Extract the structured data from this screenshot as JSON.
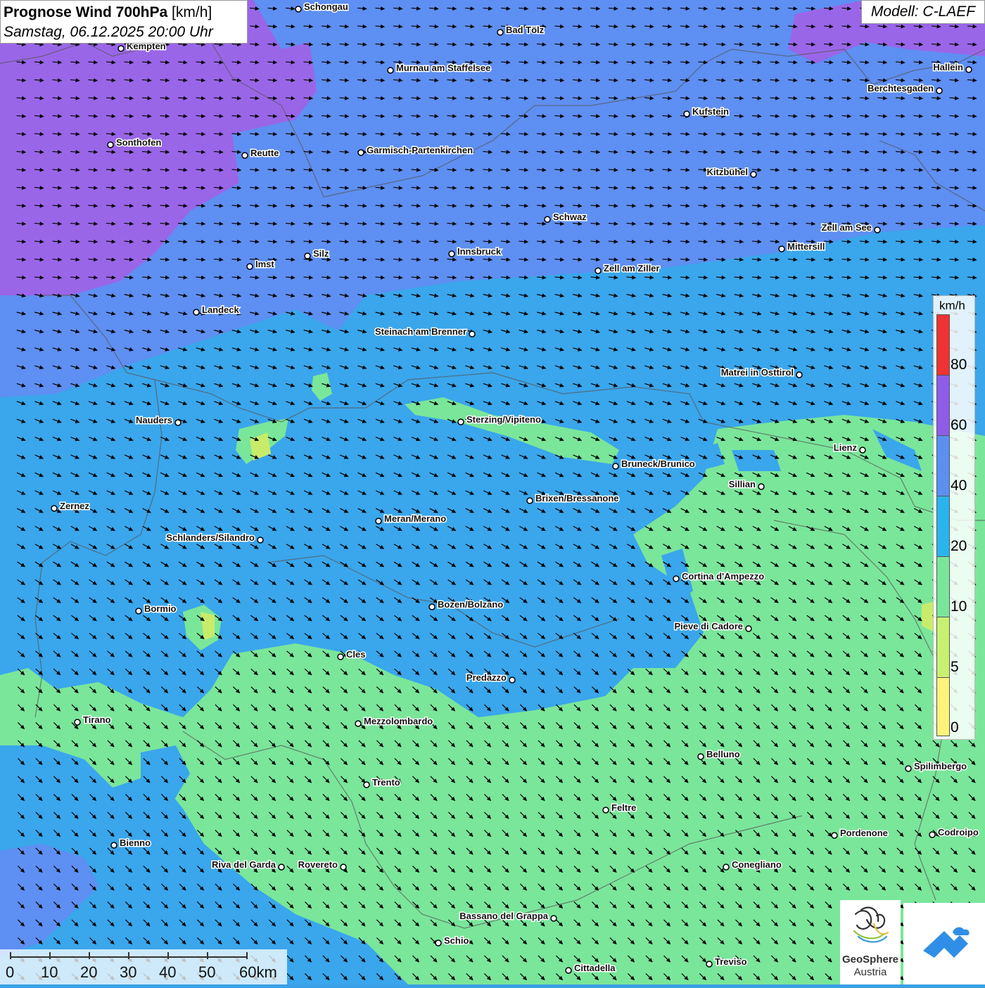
{
  "title": {
    "main": "Prognose Wind 700hPa",
    "unit": "[km/h]",
    "datetime": "Samstag, 06.12.2025 20:00 Uhr"
  },
  "model": "Modell: C-LAEF",
  "legend": {
    "unit": "km/h",
    "ticks": [
      "80",
      "60",
      "40",
      "20",
      "10",
      "5",
      "0"
    ],
    "colors": [
      "#f03232",
      "#8e5ce8",
      "#5b8ff0",
      "#2ab4ee",
      "#7ae69a",
      "#c8f070",
      "#fbf37a"
    ]
  },
  "scale": {
    "labels": [
      "0",
      "10",
      "20",
      "30",
      "40",
      "50",
      "60km"
    ]
  },
  "logos": {
    "geosphere_name": "GeoSphere",
    "geosphere_sub": "Austria",
    "geosphere_icon": "geosphere-swirl-icon",
    "second_icon": "mountain-cloud-icon"
  },
  "cities": [
    {
      "name": "Schongau"
    },
    {
      "name": "Bad Tölz"
    },
    {
      "name": "Kempten"
    },
    {
      "name": "Murnau am Staffelsee"
    },
    {
      "name": "Hallein"
    },
    {
      "name": "Berchtesgaden"
    },
    {
      "name": "Kufstein"
    },
    {
      "name": "Sonthofen"
    },
    {
      "name": "Reutte"
    },
    {
      "name": "Garmisch-Partenkirchen"
    },
    {
      "name": "Kitzbühel"
    },
    {
      "name": "Schwaz"
    },
    {
      "name": "Zell am See"
    },
    {
      "name": "Mittersill"
    },
    {
      "name": "Innsbruck"
    },
    {
      "name": "Silz"
    },
    {
      "name": "Imst"
    },
    {
      "name": "Zell am Ziller"
    },
    {
      "name": "Landeck"
    },
    {
      "name": "Steinach am Brenner"
    },
    {
      "name": "Matrei in Osttirol"
    },
    {
      "name": "Nauders"
    },
    {
      "name": "Sterzing/Vipiteno"
    },
    {
      "name": "Lienz"
    },
    {
      "name": "Bruneck/Brunico"
    },
    {
      "name": "Sillian"
    },
    {
      "name": "Zernez"
    },
    {
      "name": "Brixen/Bressanone"
    },
    {
      "name": "Meran/Merano"
    },
    {
      "name": "Schlanders/Silandro"
    },
    {
      "name": "Cortina d'Ampezzo"
    },
    {
      "name": "Bozen/Bolzano"
    },
    {
      "name": "Bormio"
    },
    {
      "name": "Pieve di Cadore"
    },
    {
      "name": "Cles"
    },
    {
      "name": "Predazzo"
    },
    {
      "name": "Tirano"
    },
    {
      "name": "Mezzolombardo"
    },
    {
      "name": "Belluno"
    },
    {
      "name": "Spilimbergo"
    },
    {
      "name": "Trento"
    },
    {
      "name": "Feltre"
    },
    {
      "name": "Bienno"
    },
    {
      "name": "Pordenone"
    },
    {
      "name": "Codroipo"
    },
    {
      "name": "Riva del Garda"
    },
    {
      "name": "Rovereto"
    },
    {
      "name": "Conegliano"
    },
    {
      "name": "Bassano del Grappa"
    },
    {
      "name": "Schio"
    },
    {
      "name": "Treviso"
    },
    {
      "name": "Cittadella"
    }
  ]
}
